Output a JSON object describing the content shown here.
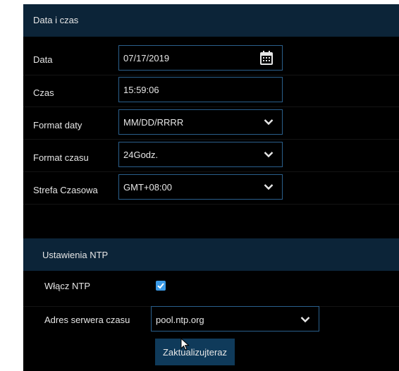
{
  "date_time_section": {
    "title": "Data i czas",
    "date": {
      "label": "Data",
      "value": "07/17/2019"
    },
    "time": {
      "label": "Czas",
      "value": "15:59:06"
    },
    "date_format": {
      "label": "Format daty",
      "value": "MM/DD/RRRR"
    },
    "time_format": {
      "label": "Format czasu",
      "value": "24Godz."
    },
    "timezone": {
      "label": "Strefa Czasowa",
      "value": "GMT+08:00"
    }
  },
  "ntp_section": {
    "title": "Ustawienia NTP",
    "enable_ntp": {
      "label": "Włącz NTP",
      "checked": true
    },
    "server": {
      "label": "Adres serwera czasu",
      "value": "pool.ntp.org"
    },
    "update_button": "Zaktualizujteraz"
  },
  "colors": {
    "header_bg": "#0c2438",
    "field_border": "#2a5f8c",
    "checkbox": "#3b9be8",
    "button_bg": "#0f3a5a"
  },
  "icons": [
    "calendar-icon",
    "chevron-down-icon",
    "checkmark-icon",
    "mouse-cursor-icon"
  ]
}
